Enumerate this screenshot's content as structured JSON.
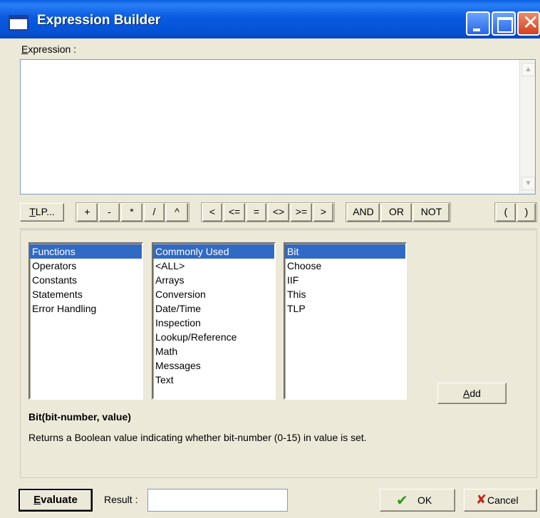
{
  "window": {
    "title": "Expression Builder"
  },
  "expression": {
    "label_u": "E",
    "label_rest": "xpression :",
    "value": ""
  },
  "operators": {
    "tlp_u": "T",
    "tlp_rest": "LP...",
    "arith": [
      "+",
      "-",
      "*",
      "/",
      "^"
    ],
    "compare": [
      "<",
      "<=",
      "=",
      "<>",
      ">=",
      ">"
    ],
    "logic": [
      "AND",
      "OR",
      "NOT"
    ],
    "parens": [
      "(",
      ")"
    ]
  },
  "lists": {
    "categories": [
      "Functions",
      "Operators",
      "Constants",
      "Statements",
      "Error Handling"
    ],
    "categories_selected": 0,
    "groups": [
      "Commonly Used",
      "<ALL>",
      "Arrays",
      "Conversion",
      "Date/Time",
      "Inspection",
      "Lookup/Reference",
      "Math",
      "Messages",
      "Text"
    ],
    "groups_selected": 0,
    "items": [
      "Bit",
      "Choose",
      "IIF",
      "This",
      "TLP"
    ],
    "items_selected": 0
  },
  "add_button": {
    "u": "A",
    "rest": "dd"
  },
  "function_info": {
    "signature": "Bit(bit-number, value)",
    "description": "Returns a Boolean value indicating whether bit-number (0-15) in value is set."
  },
  "bottom": {
    "evaluate_u": "E",
    "evaluate_rest": "valuate",
    "result_label": "Result :",
    "result_value": "",
    "ok_label": "OK",
    "cancel_label": "Cancel"
  },
  "colors": {
    "title_bar": "#0553d6",
    "selection": "#316ac5",
    "ok_check": "#2a9a1a",
    "cancel_x": "#c0281a"
  }
}
